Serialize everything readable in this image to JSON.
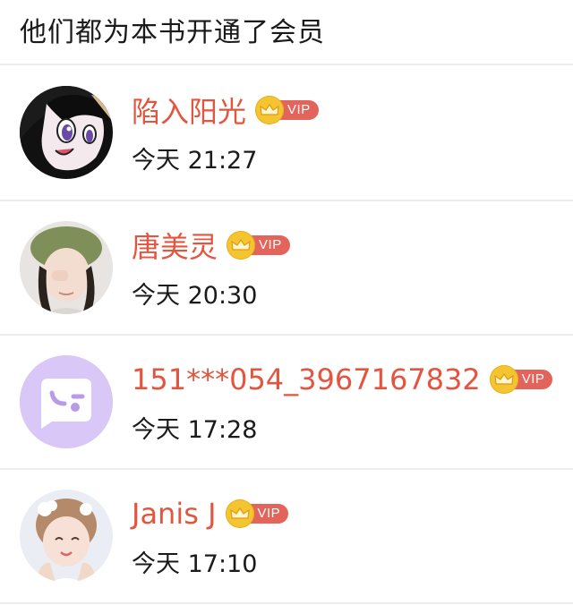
{
  "header": {
    "title": "他们都为本书开通了会员"
  },
  "members": [
    {
      "name": "陷入阳光",
      "time": "今天 21:27",
      "badge": "VIP",
      "avatar_icon": "anime-avatar"
    },
    {
      "name": "唐美灵",
      "time": "今天 20:30",
      "badge": "VIP",
      "avatar_icon": "photo-avatar"
    },
    {
      "name": "151***054_3967167832",
      "time": "今天 17:28",
      "badge": "VIP",
      "avatar_icon": "default-chat-avatar"
    },
    {
      "name": "Janis J",
      "time": "今天 17:10",
      "badge": "VIP",
      "avatar_icon": "photo-avatar"
    }
  ],
  "colors": {
    "name": "#e4553f",
    "vip_pill": "#e3645a",
    "crown": "#f5c531",
    "divider": "#ececec",
    "default_avatar_bg": "#d9c8f7"
  }
}
